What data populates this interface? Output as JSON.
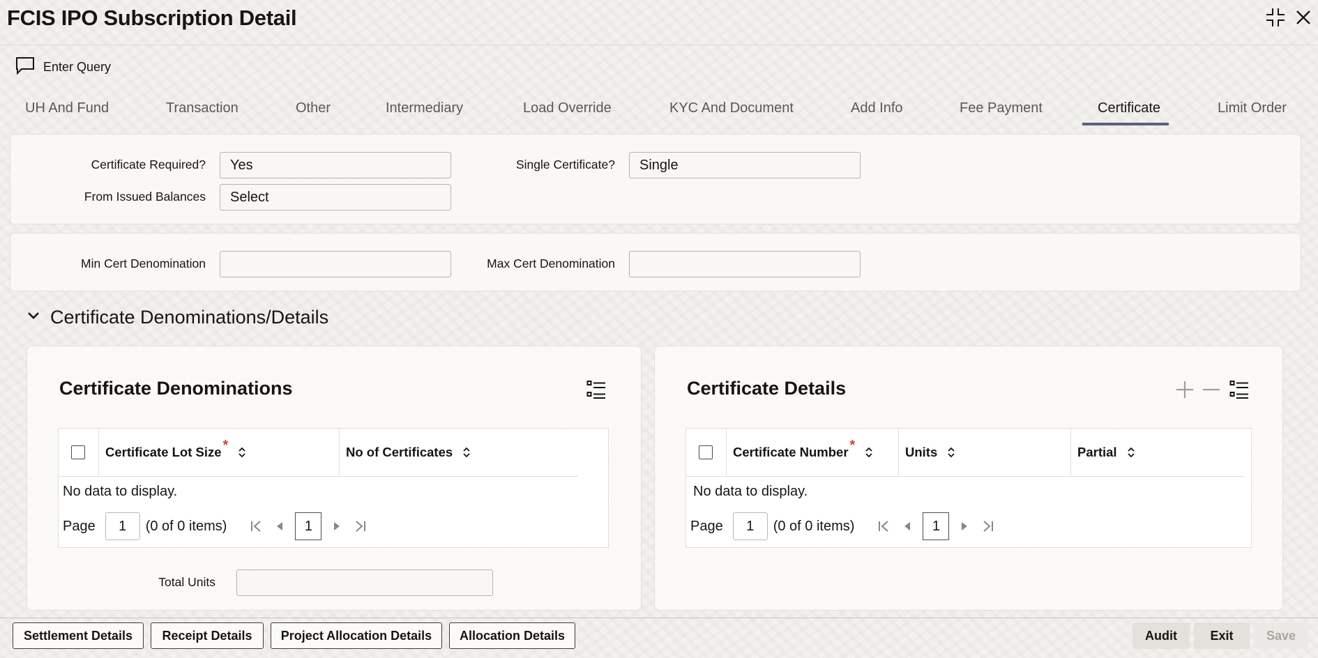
{
  "window": {
    "title": "FCIS IPO Subscription Detail"
  },
  "toolbar": {
    "enter_query": "Enter Query"
  },
  "tabs": [
    {
      "label": "UH And Fund"
    },
    {
      "label": "Transaction"
    },
    {
      "label": "Other"
    },
    {
      "label": "Intermediary"
    },
    {
      "label": "Load Override"
    },
    {
      "label": "KYC And Document"
    },
    {
      "label": "Add Info"
    },
    {
      "label": "Fee Payment"
    },
    {
      "label": "Certificate",
      "active": true
    },
    {
      "label": "Limit Order"
    }
  ],
  "certificate": {
    "required_label": "Certificate Required?",
    "required_value": "Yes",
    "single_label": "Single Certificate?",
    "single_value": "Single",
    "issued_label": "From Issued Balances",
    "issued_value": "Select",
    "min_label": "Min Cert Denomination",
    "min_value": "",
    "max_label": "Max Cert Denomination",
    "max_value": ""
  },
  "section": {
    "title": "Certificate Denominations/Details"
  },
  "denominations": {
    "title": "Certificate Denominations",
    "columns": [
      "Certificate Lot Size",
      "No of Certificates"
    ],
    "no_data": "No data to display.",
    "page_label": "Page",
    "page_value": "1",
    "items_info": "(0 of 0 items)",
    "current_page": "1",
    "total_units_label": "Total Units",
    "total_units_value": ""
  },
  "details": {
    "title": "Certificate Details",
    "columns": [
      "Certificate Number",
      "Units",
      "Partial"
    ],
    "no_data": "No data to display.",
    "page_label": "Page",
    "page_value": "1",
    "items_info": "(0 of 0 items)",
    "current_page": "1"
  },
  "footer": {
    "settlement": "Settlement Details",
    "receipt": "Receipt Details",
    "project_allocation": "Project Allocation Details",
    "allocation": "Allocation Details",
    "audit": "Audit",
    "exit": "Exit",
    "save": "Save"
  },
  "colors": {
    "accent": "#5d5f7e",
    "required": "#c74634"
  }
}
